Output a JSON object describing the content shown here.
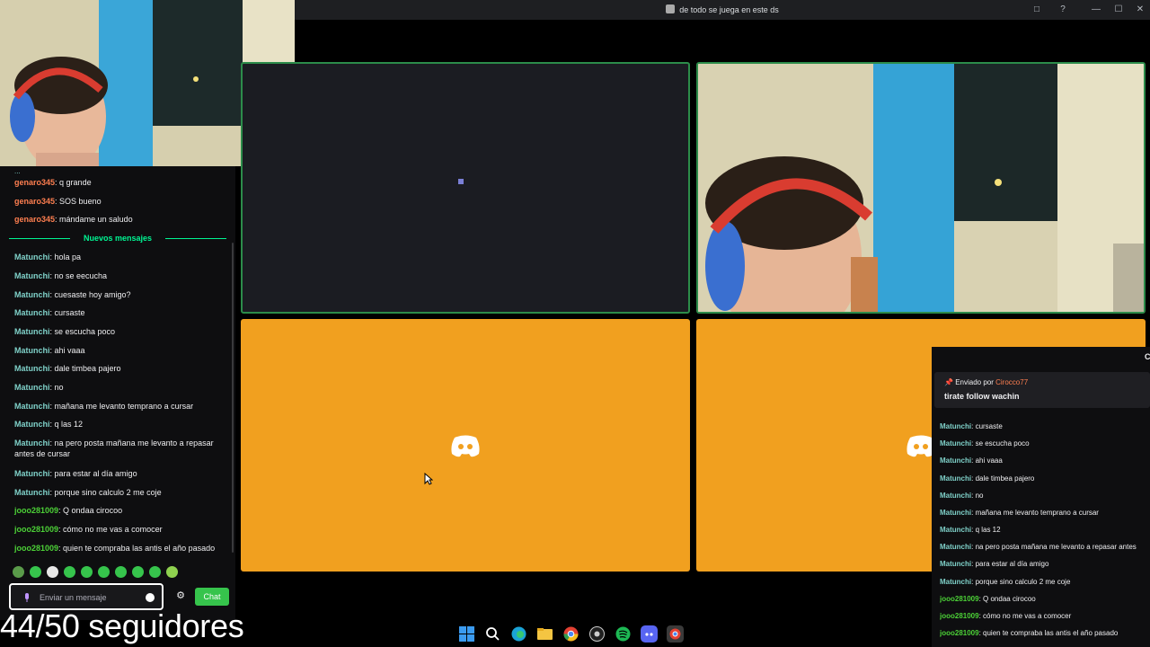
{
  "window": {
    "title": "de todo se juega en este ds",
    "buttons": [
      "□",
      "?",
      "—",
      "☐",
      "✕"
    ]
  },
  "chat": {
    "partial_top": "...",
    "messages_before": [
      {
        "user": "genaro345",
        "text": "q grande",
        "color": "#ff7f50"
      },
      {
        "user": "genaro345",
        "text": "SOS bueno",
        "color": "#ff7f50"
      },
      {
        "user": "genaro345",
        "text": "mándame un saludo",
        "color": "#ff7f50"
      }
    ],
    "new_messages_label": "Nuevos mensajes",
    "messages_after": [
      {
        "user": "Matunchi",
        "text": "hola pa",
        "color": "#7fd1c9"
      },
      {
        "user": "Matunchi",
        "text": "no se eecucha",
        "color": "#7fd1c9"
      },
      {
        "user": "Matunchi",
        "text": "cuesaste hoy amigo?",
        "color": "#7fd1c9"
      },
      {
        "user": "Matunchi",
        "text": "cursaste",
        "color": "#7fd1c9"
      },
      {
        "user": "Matunchi",
        "text": "se escucha poco",
        "color": "#7fd1c9"
      },
      {
        "user": "Matunchi",
        "text": "ahi vaaa",
        "color": "#7fd1c9"
      },
      {
        "user": "Matunchi",
        "text": "dale timbea pajero",
        "color": "#7fd1c9"
      },
      {
        "user": "Matunchi",
        "text": "no",
        "color": "#7fd1c9"
      },
      {
        "user": "Matunchi",
        "text": "mañana me levanto temprano a cursar",
        "color": "#7fd1c9"
      },
      {
        "user": "Matunchi",
        "text": "q las 12",
        "color": "#7fd1c9"
      },
      {
        "user": "Matunchi",
        "text": "na pero posta mañana me levanto a repasar antes de cursar",
        "color": "#7fd1c9"
      },
      {
        "user": "Matunchi",
        "text": "para estar al día amigo",
        "color": "#7fd1c9"
      },
      {
        "user": "Matunchi",
        "text": "porque sino calculo 2 me coje",
        "color": "#7fd1c9"
      },
      {
        "user": "jooo281009",
        "text": "Q ondaa cirocoo",
        "color": "#4cd137"
      },
      {
        "user": "jooo281009",
        "text": "cómo no me vas a comocer",
        "color": "#4cd137"
      },
      {
        "user": "jooo281009",
        "text": "quien te compraba las antis el año pasado",
        "color": "#4cd137"
      }
    ],
    "input_placeholder": "Enviar un mensaje",
    "send_label": "Chat",
    "accent": "#36c44c"
  },
  "follower_goal": "44/50 seguidores",
  "overlay": {
    "pinned_by_label": "Enviado por",
    "pinned_sender": "Cirocco77",
    "pinned_text": "tirate follow wachin",
    "corner_char": "C",
    "messages": [
      {
        "user": "Matunchi",
        "text": "cursaste",
        "color": "#7fd1c9"
      },
      {
        "user": "Matunchi",
        "text": "se escucha poco",
        "color": "#7fd1c9"
      },
      {
        "user": "Matunchi",
        "text": "ahi vaaa",
        "color": "#7fd1c9"
      },
      {
        "user": "Matunchi",
        "text": "dale timbea pajero",
        "color": "#7fd1c9"
      },
      {
        "user": "Matunchi",
        "text": "no",
        "color": "#7fd1c9"
      },
      {
        "user": "Matunchi",
        "text": "mañana me levanto temprano a cursar",
        "color": "#7fd1c9"
      },
      {
        "user": "Matunchi",
        "text": "q las 12",
        "color": "#7fd1c9"
      },
      {
        "user": "Matunchi",
        "text": "na pero posta mañana me levanto a repasar antes",
        "color": "#7fd1c9"
      },
      {
        "user": "Matunchi",
        "text": "para estar al día amigo",
        "color": "#7fd1c9"
      },
      {
        "user": "Matunchi",
        "text": "porque sino calculo 2 me coje",
        "color": "#7fd1c9"
      },
      {
        "user": "jooo281009",
        "text": "Q ondaa cirocoo",
        "color": "#4cd137"
      },
      {
        "user": "jooo281009",
        "text": "cómo no me vas a comocer",
        "color": "#4cd137"
      },
      {
        "user": "jooo281009",
        "text": "quien te compraba las antis el año pasado",
        "color": "#4cd137"
      }
    ]
  },
  "taskbar": {
    "icons": [
      "windows-start-icon",
      "search-icon",
      "edge-icon",
      "file-explorer-icon",
      "chrome-icon",
      "obs-icon",
      "spotify-icon",
      "discord-icon",
      "chrome-app-icon"
    ]
  },
  "colors": {
    "discord_tile": "#f1a01f",
    "speaking_border": "#2c8c4a"
  }
}
